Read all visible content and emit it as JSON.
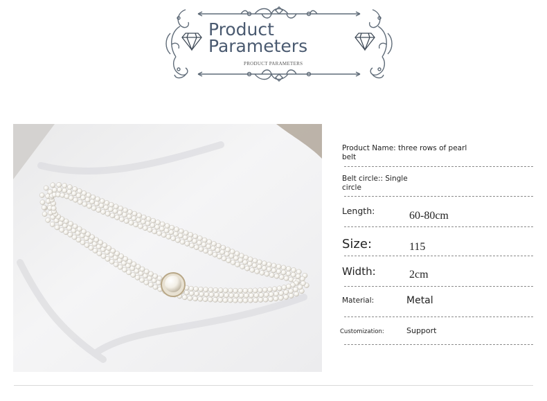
{
  "header": {
    "title_line1": "Product",
    "title_line2": "Parameters",
    "subtitle": "PRODUCT PARAMETERS"
  },
  "product_image": {
    "alt": "three rows of pearl belt"
  },
  "parameters": [
    {
      "label": "Product Name: three rows of pearl belt",
      "value": ""
    },
    {
      "label": "Belt circle:: Single circle",
      "value": ""
    },
    {
      "label": "Length:",
      "value": "60-80cm"
    },
    {
      "label": "Size:",
      "value": "115"
    },
    {
      "label": "Width:",
      "value": "2cm"
    },
    {
      "label": "Material:",
      "value": "Metal"
    },
    {
      "label": "Customization:",
      "value": "Support"
    }
  ],
  "colors": {
    "title": "#4a5a70",
    "ornament": "#5f6b78",
    "divider": "#8a8a8a"
  }
}
